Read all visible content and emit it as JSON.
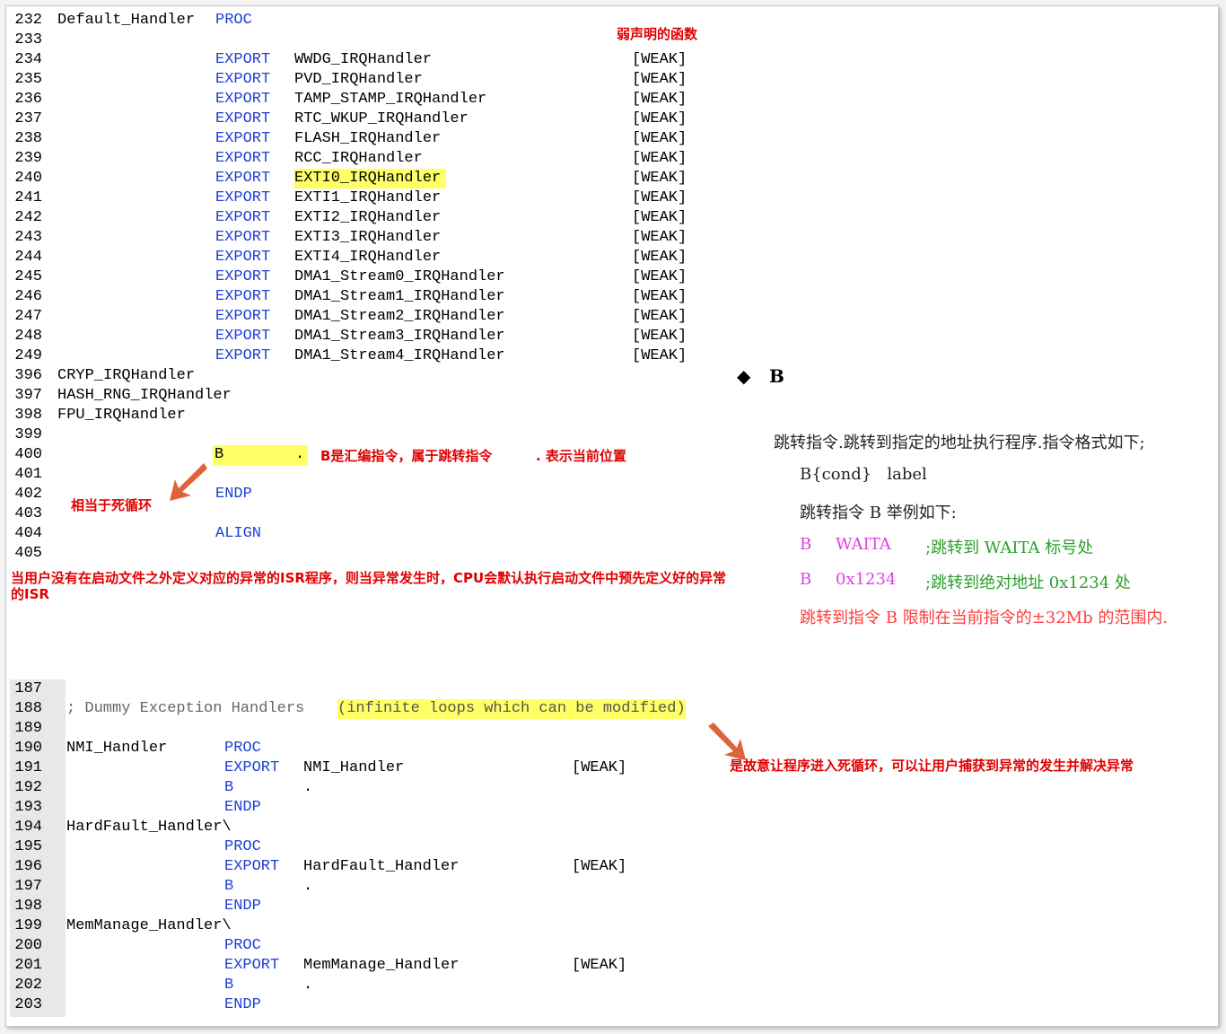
{
  "top_listing": {
    "lines": [
      {
        "n": "232",
        "c1": "Default_Handler",
        "c2": "PROC",
        "kw2": true
      },
      {
        "n": "233"
      },
      {
        "n": "234",
        "c2": "EXPORT",
        "name": "WWDG_IRQHandler",
        "weak": "[WEAK]",
        "kw2": true
      },
      {
        "n": "235",
        "c2": "EXPORT",
        "name": "PVD_IRQHandler",
        "weak": "[WEAK]",
        "kw2": true
      },
      {
        "n": "236",
        "c2": "EXPORT",
        "name": "TAMP_STAMP_IRQHandler",
        "weak": "[WEAK]",
        "kw2": true
      },
      {
        "n": "237",
        "c2": "EXPORT",
        "name": "RTC_WKUP_IRQHandler",
        "weak": "[WEAK]",
        "kw2": true
      },
      {
        "n": "238",
        "c2": "EXPORT",
        "name": "FLASH_IRQHandler",
        "weak": "[WEAK]",
        "kw2": true
      },
      {
        "n": "239",
        "c2": "EXPORT",
        "name": "RCC_IRQHandler",
        "weak": "[WEAK]",
        "kw2": true
      },
      {
        "n": "240",
        "c2": "EXPORT",
        "name": "EXTI0_IRQHandler",
        "weak": "[WEAK]",
        "kw2": true,
        "hl": true
      },
      {
        "n": "241",
        "c2": "EXPORT",
        "name": "EXTI1_IRQHandler",
        "weak": "[WEAK]",
        "kw2": true
      },
      {
        "n": "242",
        "c2": "EXPORT",
        "name": "EXTI2_IRQHandler",
        "weak": "[WEAK]",
        "kw2": true
      },
      {
        "n": "243",
        "c2": "EXPORT",
        "name": "EXTI3_IRQHandler",
        "weak": "[WEAK]",
        "kw2": true
      },
      {
        "n": "244",
        "c2": "EXPORT",
        "name": "EXTI4_IRQHandler",
        "weak": "[WEAK]",
        "kw2": true
      },
      {
        "n": "245",
        "c2": "EXPORT",
        "name": "DMA1_Stream0_IRQHandler",
        "weak": "[WEAK]",
        "kw2": true
      },
      {
        "n": "246",
        "c2": "EXPORT",
        "name": "DMA1_Stream1_IRQHandler",
        "weak": "[WEAK]",
        "kw2": true
      },
      {
        "n": "247",
        "c2": "EXPORT",
        "name": "DMA1_Stream2_IRQHandler",
        "weak": "[WEAK]",
        "kw2": true
      },
      {
        "n": "248",
        "c2": "EXPORT",
        "name": "DMA1_Stream3_IRQHandler",
        "weak": "[WEAK]",
        "kw2": true
      },
      {
        "n": "249",
        "c2": "EXPORT",
        "name": "DMA1_Stream4_IRQHandler",
        "weak": "[WEAK]",
        "kw2": true
      },
      {
        "n": "396",
        "c1": "CRYP_IRQHandler"
      },
      {
        "n": "397",
        "c1": "HASH_RNG_IRQHandler"
      },
      {
        "n": "398",
        "c1": "FPU_IRQHandler"
      },
      {
        "n": "399"
      },
      {
        "n": "400",
        "b": "B",
        "dot": "."
      },
      {
        "n": "401"
      },
      {
        "n": "402",
        "c2": "ENDP",
        "kw2": true
      },
      {
        "n": "403"
      },
      {
        "n": "404",
        "c2": "ALIGN",
        "kw2": true
      },
      {
        "n": "405"
      }
    ]
  },
  "bottom_listing": {
    "lines": [
      {
        "n": "187"
      },
      {
        "n": "188",
        "comment": "; Dummy Exception Handlers ",
        "comment_hl": "(infinite loops which can be modified)"
      },
      {
        "n": "189"
      },
      {
        "n": "190",
        "c1": "NMI_Handler",
        "c2": "PROC"
      },
      {
        "n": "191",
        "c2": "EXPORT",
        "name": "NMI_Handler",
        "weak": "[WEAK]"
      },
      {
        "n": "192",
        "c2": "B",
        "name": "."
      },
      {
        "n": "193",
        "c2": "ENDP"
      },
      {
        "n": "194",
        "c1": "HardFault_Handler\\"
      },
      {
        "n": "195",
        "c2": "PROC"
      },
      {
        "n": "196",
        "c2": "EXPORT",
        "name": "HardFault_Handler",
        "weak": "[WEAK]"
      },
      {
        "n": "197",
        "c2": "B",
        "name": "."
      },
      {
        "n": "198",
        "c2": "ENDP"
      },
      {
        "n": "199",
        "c1": "MemManage_Handler\\"
      },
      {
        "n": "200",
        "c2": "PROC"
      },
      {
        "n": "201",
        "c2": "EXPORT",
        "name": "MemManage_Handler",
        "weak": "[WEAK]"
      },
      {
        "n": "202",
        "c2": "B",
        "name": "."
      },
      {
        "n": "203",
        "c2": "ENDP"
      }
    ]
  },
  "annotations": {
    "weak_note": "弱声明的函数",
    "b_note": "B是汇编指令，属于跳转指令",
    "dot_note": ". 表示当前位置",
    "loop_note": "相当于死循环",
    "isr_note": "当用户没有在启动文件之外定义对应的异常的ISR程序，则当异常发生时，CPU会默认执行启动文件中预先定义好的异常的ISR",
    "catch_note": "是故意让程序进入死循环，可以让用户捕获到异常的发生并解决异常"
  },
  "doc": {
    "bullet": "◆",
    "heading": "B",
    "line1": "跳转指令.跳转到指定的地址执行程序.指令格式如下;",
    "line2": "B{cond}   label",
    "line3": "跳转指令 B 举例如下:",
    "ex1_op": "B",
    "ex1_arg": "WAITA",
    "ex1_comment": ";跳转到 WAITA 标号处",
    "ex2_op": "B",
    "ex2_arg": "0x1234",
    "ex2_comment": ";跳转到绝对地址 0x1234 处",
    "line6": "跳转到指令 B 限制在当前指令的±32Mb 的范围内."
  },
  "colors": {
    "keyword": "#1f3fd6",
    "highlight": "#ffff66",
    "annotation": "#e00000",
    "arrow": "#e0623a",
    "magenta": "#e040e0",
    "green": "#2aa02a"
  }
}
